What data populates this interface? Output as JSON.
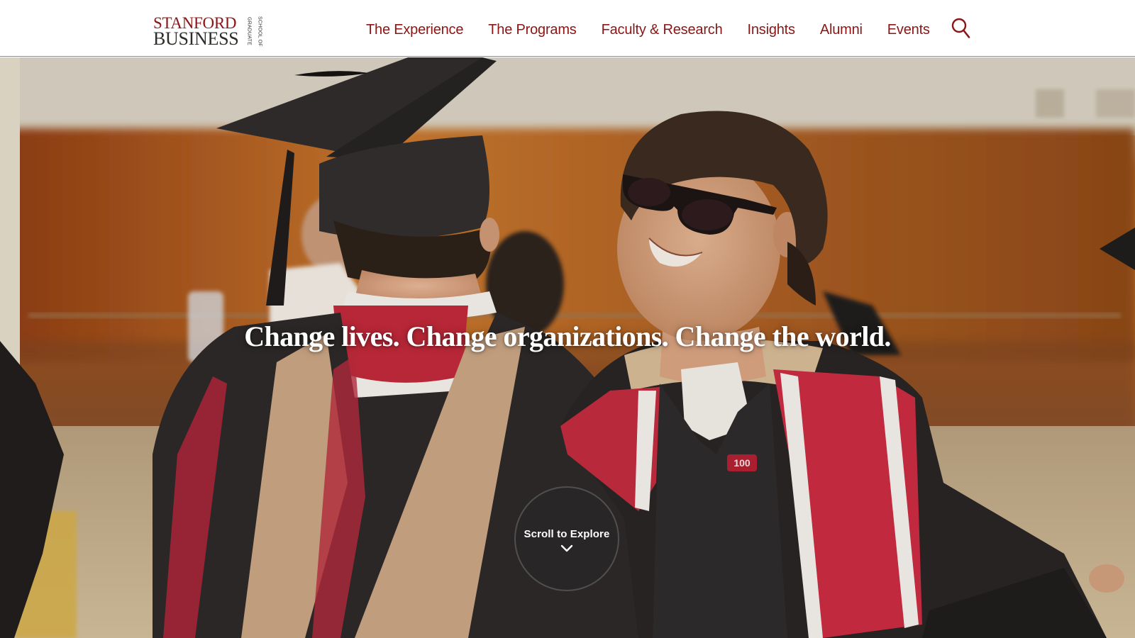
{
  "header": {
    "logo": {
      "line1": "STANFORD",
      "line2": "BUSINESS",
      "side_text_1": "GRADUATE",
      "side_text_2": "SCHOOL OF"
    },
    "nav": [
      {
        "label": "The Experience"
      },
      {
        "label": "The Programs"
      },
      {
        "label": "Faculty & Research"
      },
      {
        "label": "Insights"
      },
      {
        "label": "Alumni"
      },
      {
        "label": "Events"
      }
    ],
    "search_icon": "search-icon"
  },
  "hero": {
    "tagline": "Change lives. Change organizations. Change the world.",
    "scroll_label": "Scroll to Explore",
    "scroll_icon": "chevron-down-icon"
  },
  "colors": {
    "brand": "#8c1515",
    "header_bg": "#ffffff",
    "scroll_button_bg": "#282626"
  }
}
